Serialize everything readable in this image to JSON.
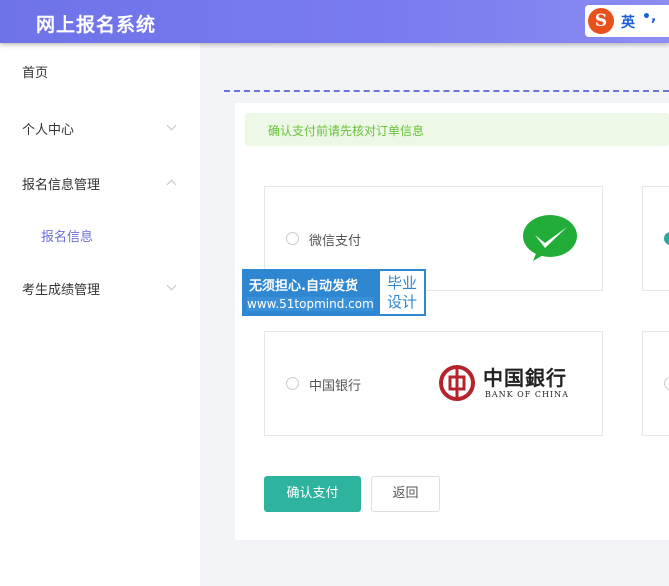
{
  "header": {
    "title": "网上报名系统",
    "ime_logo": "S",
    "ime_mode": "英",
    "ime_punct": "•,"
  },
  "sidebar": {
    "items": [
      {
        "label": "首页",
        "has_chevron": false
      },
      {
        "label": "个人中心",
        "has_chevron": true,
        "expanded": false
      },
      {
        "label": "报名信息管理",
        "has_chevron": true,
        "expanded": true
      },
      {
        "label": "考生成绩管理",
        "has_chevron": true,
        "expanded": false
      }
    ],
    "sub_items": [
      {
        "label": "报名信息",
        "active": true
      }
    ]
  },
  "main": {
    "alert": "确认支付前请先核对订单信息",
    "payment_options": [
      {
        "label": "微信支付",
        "selected": false,
        "icon": "wechat-pay-icon"
      },
      {
        "label": "",
        "selected": true,
        "icon": ""
      },
      {
        "label": "中国银行",
        "selected": false,
        "icon": "bank-of-china-logo"
      },
      {
        "label": "",
        "selected": false,
        "icon": ""
      }
    ],
    "boc_logo_cn": "中国銀行",
    "boc_logo_en": "BANK OF CHINA",
    "confirm_button": "确认支付",
    "back_button": "返回"
  },
  "watermark": {
    "line1": "无须担心.自动发货",
    "line2": "www.51topmind.com",
    "right": "毕业设计"
  },
  "colors": {
    "header": "#7a7bf0",
    "primary": "#2eb39e",
    "alert_bg": "#edf8e6",
    "alert_text": "#67c23a",
    "active_sub": "#6d6fd8"
  }
}
